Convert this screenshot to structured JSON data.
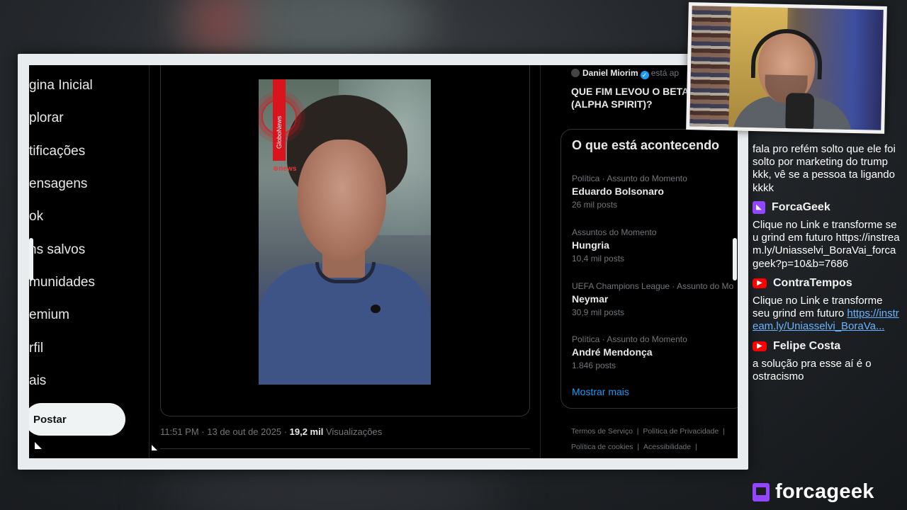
{
  "left_nav": {
    "items": [
      "gina Inicial",
      "plorar",
      "tificações",
      "ensagens",
      "ok",
      "ns salvos",
      "munidades",
      "emium",
      "rfil",
      "ais"
    ],
    "post_label": "Postar"
  },
  "video": {
    "channel_bar_text": "GloboNews",
    "logo_text": "news"
  },
  "tweet_meta": {
    "time": "11:51 PM",
    "sep1": " · ",
    "date": "13 de out de 2025",
    "sep2": " · ",
    "views_count": "19,2 mil",
    "views_label": " Visualizações"
  },
  "right_column": {
    "post_user": "Daniel Miorim",
    "post_user_status": "está ap",
    "post_headline": "QUE FIM LEVOU O BETAS (ALPHA SPIRIT)?",
    "trends_title": "O que está acontecendo",
    "trends": [
      {
        "context": "Política · Assunto do Momento",
        "name": "Eduardo Bolsonaro",
        "count": "26 mil posts"
      },
      {
        "context": "Assuntos do Momento",
        "name": "Hungria",
        "count": "10,4 mil posts"
      },
      {
        "context": "UEFA Champions League · Assunto do Mo",
        "name": "Neymar",
        "count": "30,9 mil posts"
      },
      {
        "context": "Política · Assunto do Momento",
        "name": "André Mendonça",
        "count": "1.846 posts"
      }
    ],
    "show_more": "Mostrar mais",
    "footer": [
      "Termos de Serviço",
      "|",
      "Política de Privacidade",
      "|",
      "Política de cookies",
      "|",
      "Acessibilidade",
      "|"
    ]
  },
  "chat": {
    "first_msg": "fala pro refém solto que ele foi solto por marketing do trump kkk, vê se a pessoa ta ligando kkkk",
    "messages": [
      {
        "platform": "twitch",
        "user": "ForcaGeek",
        "text": "Clique no Link e transforme seu grind em futuro https://instream.ly/Uniasselvi_BoraVai_forcageek?p=10&b=7686"
      },
      {
        "platform": "youtube",
        "user": "ContraTempos",
        "text": "Clique no Link e transforme seu grind em futuro",
        "link": "https://instream.ly/Uniasselvi_BoraVa..."
      },
      {
        "platform": "youtube",
        "user": "Felipe Costa",
        "text": "a solução pra esse aí é o ostracismo"
      }
    ]
  },
  "brand": {
    "name": "forcageek"
  },
  "colors": {
    "accent_blue": "#1d9bf0",
    "twitch_purple": "#9146ff",
    "youtube_red": "#ff0000",
    "news_red": "#d9141d"
  }
}
